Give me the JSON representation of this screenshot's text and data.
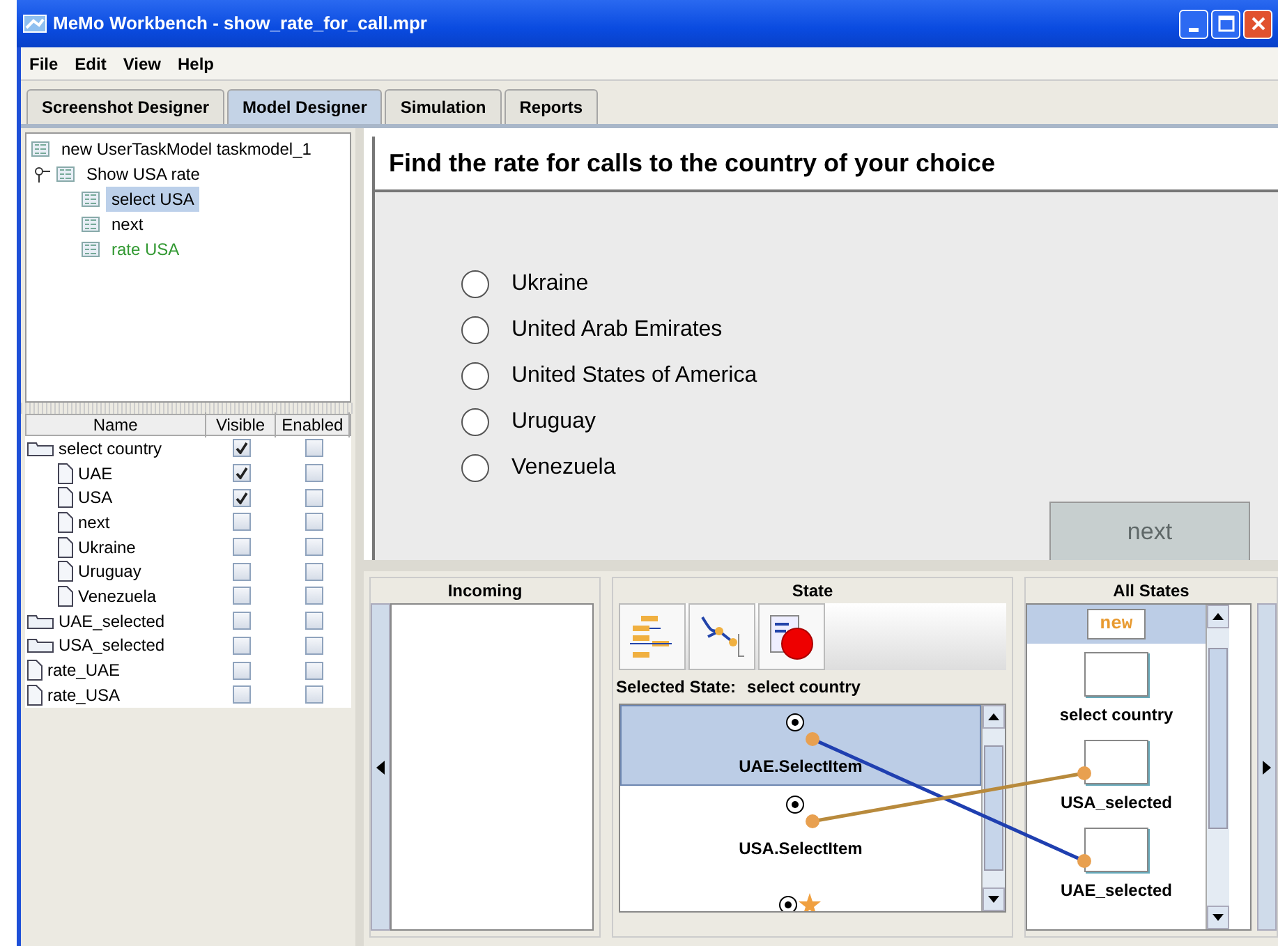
{
  "window": {
    "title": "MeMo Workbench - show_rate_for_call.mpr"
  },
  "menu": [
    "File",
    "Edit",
    "View",
    "Help"
  ],
  "tabs": [
    {
      "label": "Screenshot Designer",
      "selected": false
    },
    {
      "label": "Model Designer",
      "selected": true
    },
    {
      "label": "Simulation",
      "selected": false
    },
    {
      "label": "Reports",
      "selected": false
    }
  ],
  "task_tree": {
    "label": "new UserTaskModel taskmodel_1",
    "children": [
      {
        "label": "Show USA rate",
        "expanded": true,
        "children": [
          {
            "label": "select USA",
            "selected": true,
            "color": "#000000"
          },
          {
            "label": "next",
            "selected": false,
            "color": "#000000"
          },
          {
            "label": "rate USA",
            "selected": false,
            "color": "#339933"
          }
        ]
      }
    ]
  },
  "widget_table": {
    "columns": [
      "Name",
      "Visible",
      "Enabled"
    ],
    "rows": [
      {
        "name": "select country",
        "kind": "folder",
        "visible": true,
        "enabled": false,
        "children": [
          {
            "name": "UAE",
            "kind": "page",
            "visible": true,
            "enabled": false
          },
          {
            "name": "USA",
            "kind": "page",
            "visible": true,
            "enabled": false
          },
          {
            "name": "next",
            "kind": "page",
            "visible": false,
            "enabled": false
          },
          {
            "name": "Ukraine",
            "kind": "page",
            "visible": false,
            "enabled": false
          },
          {
            "name": "Uruguay",
            "kind": "page",
            "visible": false,
            "enabled": false
          },
          {
            "name": "Venezuela",
            "kind": "page",
            "visible": false,
            "enabled": false
          }
        ]
      },
      {
        "name": "UAE_selected",
        "kind": "folder",
        "visible": false,
        "enabled": false
      },
      {
        "name": "USA_selected",
        "kind": "folder",
        "visible": false,
        "enabled": false
      },
      {
        "name": "rate_UAE",
        "kind": "page",
        "visible": false,
        "enabled": false
      },
      {
        "name": "rate_USA",
        "kind": "page",
        "visible": false,
        "enabled": false
      }
    ]
  },
  "preview": {
    "title": "Find the rate for calls to the country of your choice",
    "options": [
      {
        "label": "Ukraine",
        "selected": false
      },
      {
        "label": "United Arab Emirates",
        "selected": false
      },
      {
        "label": "United States of America",
        "selected": false
      },
      {
        "label": "Uruguay",
        "selected": false
      },
      {
        "label": "Venezuela",
        "selected": false
      }
    ],
    "button": {
      "label": "next",
      "disabled": true
    }
  },
  "incoming": {
    "heading": "Incoming"
  },
  "state": {
    "heading": "State",
    "selected_state_label": "Selected State:",
    "selected_state": "select country",
    "transitions": [
      {
        "label": "UAE.SelectItem",
        "selected": true,
        "color": "#1f3fb0"
      },
      {
        "label": "USA.SelectItem",
        "selected": false,
        "color": "#b88a3c"
      },
      {
        "kind": "partial",
        "selected": false
      }
    ]
  },
  "all_states": {
    "heading": "All States",
    "items": [
      {
        "kind": "new",
        "label": "new",
        "selected": true
      },
      {
        "kind": "state",
        "label": "select country",
        "selected": false
      },
      {
        "kind": "state",
        "label": "USA_selected",
        "selected": false
      },
      {
        "kind": "state",
        "label": "UAE_selected",
        "selected": false
      }
    ]
  }
}
